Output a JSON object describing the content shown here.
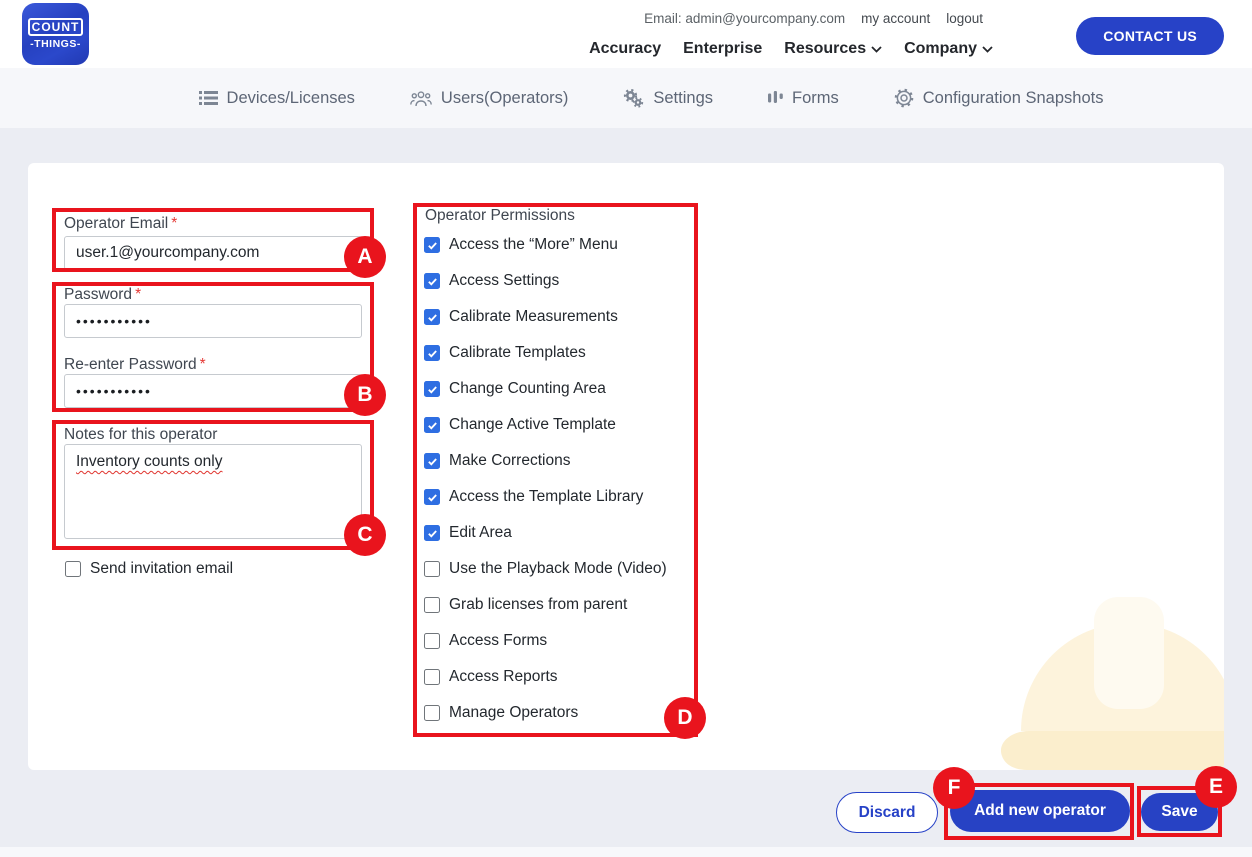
{
  "header": {
    "logo": {
      "line1": "COUNT",
      "line2": "-THINGS-"
    },
    "account": {
      "email": "Email: admin@yourcompany.com",
      "my_account": "my account",
      "logout": "logout"
    },
    "nav": [
      {
        "label": "Accuracy",
        "dropdown": false
      },
      {
        "label": "Enterprise",
        "dropdown": false
      },
      {
        "label": "Resources",
        "dropdown": true
      },
      {
        "label": "Company",
        "dropdown": true
      }
    ],
    "contact_button": "CONTACT US"
  },
  "tabs": [
    {
      "icon": "list-icon",
      "label": "Devices/Licenses"
    },
    {
      "icon": "users-icon",
      "label": "Users(Operators)"
    },
    {
      "icon": "gears-icon",
      "label": "Settings"
    },
    {
      "icon": "forms-icon",
      "label": "Forms"
    },
    {
      "icon": "gear-icon",
      "label": "Configuration Snapshots"
    }
  ],
  "form": {
    "operator_email": {
      "label": "Operator Email",
      "required_mark": "*",
      "value": "user.1@yourcompany.com"
    },
    "password": {
      "label": "Password",
      "required_mark": "*",
      "value": "•••••••••••"
    },
    "reenter_password": {
      "label": "Re-enter Password",
      "required_mark": "*",
      "value": "•••••••••••"
    },
    "notes": {
      "label": "Notes for this operator",
      "value": "Inventory counts only"
    },
    "send_invitation": {
      "label": "Send invitation email",
      "checked": false
    },
    "permissions": {
      "title": "Operator Permissions",
      "items": [
        {
          "label": "Access the “More” Menu",
          "checked": true
        },
        {
          "label": "Access Settings",
          "checked": true
        },
        {
          "label": "Calibrate Measurements",
          "checked": true
        },
        {
          "label": "Calibrate Templates",
          "checked": true
        },
        {
          "label": "Change Counting Area",
          "checked": true
        },
        {
          "label": "Change Active Template",
          "checked": true
        },
        {
          "label": "Make Corrections",
          "checked": true
        },
        {
          "label": "Access the Template Library",
          "checked": true
        },
        {
          "label": "Edit Area",
          "checked": true
        },
        {
          "label": "Use the Playback Mode (Video)",
          "checked": false
        },
        {
          "label": "Grab licenses from parent",
          "checked": false
        },
        {
          "label": "Access Forms",
          "checked": false
        },
        {
          "label": "Access Reports",
          "checked": false
        },
        {
          "label": "Manage Operators",
          "checked": false
        }
      ]
    }
  },
  "footer": {
    "discard": "Discard",
    "add_new_operator": "Add new operator",
    "save": "Save"
  },
  "annotations": {
    "a": "A",
    "b": "B",
    "c": "C",
    "d": "D",
    "e": "E",
    "f": "F"
  },
  "colors": {
    "accent_blue": "#2742c4",
    "checkbox_blue": "#2e6ee2",
    "annotation_red": "#e9141d",
    "required_red": "#e53935"
  }
}
